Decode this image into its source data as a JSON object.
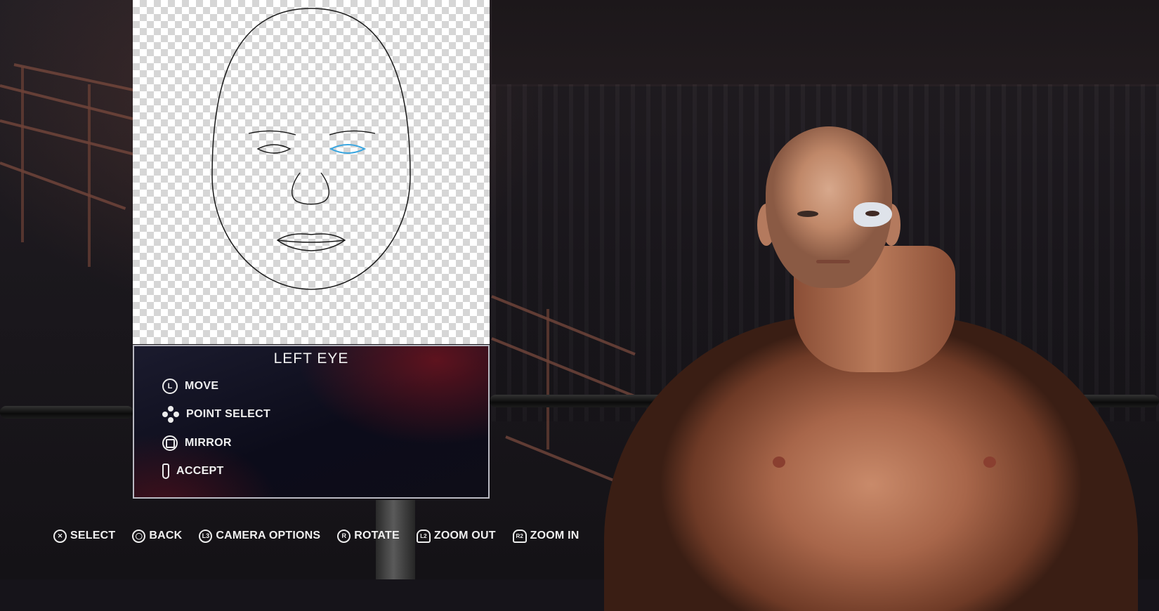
{
  "editor": {
    "selected_part": "LEFT EYE",
    "highlight_color": "#3aa6e0",
    "outline_color": "#1a1a1a",
    "options": [
      {
        "icon": "left-stick-icon",
        "glyph": "L",
        "label": "MOVE"
      },
      {
        "icon": "dpad-icon",
        "glyph": "",
        "label": "POINT SELECT"
      },
      {
        "icon": "square-button-icon",
        "glyph": "",
        "label": "MIRROR"
      },
      {
        "icon": "touchpad-stick-icon",
        "glyph": "",
        "label": "ACCEPT"
      }
    ]
  },
  "hints": [
    {
      "icon": "cross-button-icon",
      "glyph": "✕",
      "label": "SELECT"
    },
    {
      "icon": "circle-button-icon",
      "glyph": "◯",
      "label": "BACK"
    },
    {
      "icon": "l3-button-icon",
      "glyph": "L3",
      "label": "CAMERA OPTIONS"
    },
    {
      "icon": "r-stick-icon",
      "glyph": "R",
      "label": "ROTATE"
    },
    {
      "icon": "l2-trigger-icon",
      "glyph": "L2",
      "label": "ZOOM OUT"
    },
    {
      "icon": "r2-trigger-icon",
      "glyph": "R2",
      "label": "ZOOM IN"
    }
  ]
}
